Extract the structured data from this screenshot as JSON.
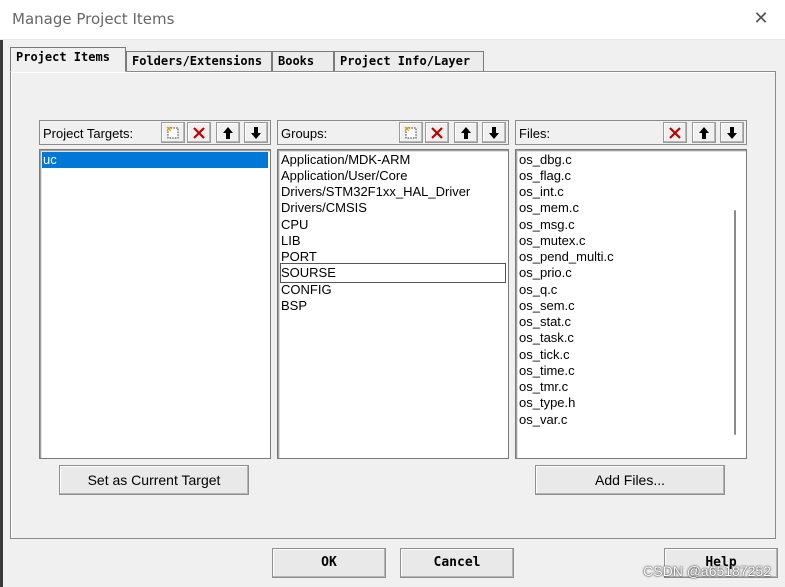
{
  "window": {
    "title": "Manage Project Items",
    "close_glyph": "✕"
  },
  "tabs": [
    {
      "label": "Project Items",
      "active": true
    },
    {
      "label": "Folders/Extensions",
      "active": false
    },
    {
      "label": "Books",
      "active": false
    },
    {
      "label": "Project Info/Layer",
      "active": false
    }
  ],
  "targets": {
    "label": "Project Targets:",
    "items": [
      "uc"
    ],
    "selected": "uc",
    "button_label": "Set as Current Target"
  },
  "groups": {
    "label": "Groups:",
    "items": [
      "Application/MDK-ARM",
      "Application/User/Core",
      "Drivers/STM32F1xx_HAL_Driver",
      "Drivers/CMSIS",
      "CPU",
      "LIB",
      "PORT",
      "SOURSE",
      "CONFIG",
      "BSP"
    ],
    "focused": "SOURSE"
  },
  "files": {
    "label": "Files:",
    "items": [
      "os_dbg.c",
      "os_flag.c",
      "os_int.c",
      "os_mem.c",
      "os_msg.c",
      "os_mutex.c",
      "os_pend_multi.c",
      "os_prio.c",
      "os_q.c",
      "os_sem.c",
      "os_stat.c",
      "os_task.c",
      "os_tick.c",
      "os_time.c",
      "os_tmr.c",
      "os_type.h",
      "os_var.c"
    ],
    "button_label": "Add Files..."
  },
  "footer": {
    "ok": "OK",
    "cancel": "Cancel",
    "help": "Help"
  },
  "watermark": "CSDN @a65187252",
  "colors": {
    "selection": "#0078d7",
    "delete_icon": "#c00000"
  }
}
